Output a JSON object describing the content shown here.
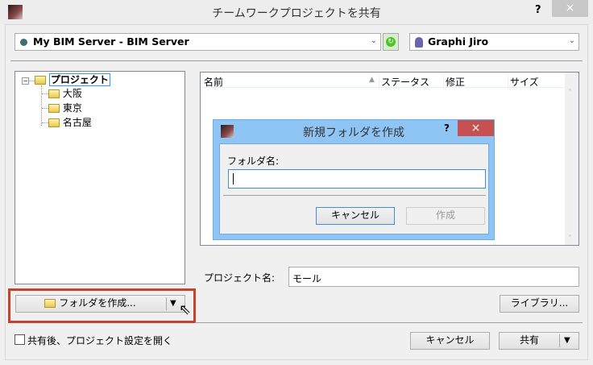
{
  "window": {
    "title": "チームワークプロジェクトを共有",
    "help": "?",
    "close": "×"
  },
  "server": {
    "selected": "My BIM Server - BIM Server"
  },
  "user": {
    "selected": "Graphi Jiro"
  },
  "tree": {
    "root": "プロジェクト",
    "children": [
      "大阪",
      "東京",
      "名古屋"
    ]
  },
  "list": {
    "columns": [
      "名前",
      "ステータス",
      "修正",
      "サイズ"
    ]
  },
  "dialog": {
    "title": "新規フォルダを作成",
    "help": "?",
    "close": "×",
    "label": "フォルダ名:",
    "value": "",
    "cancel": "キャンセル",
    "create": "作成"
  },
  "project_name": {
    "label": "プロジェクト名:",
    "value": "モール"
  },
  "buttons": {
    "create_folder": "フォルダを作成...",
    "library": "ライブラリ...",
    "cancel": "キャンセル",
    "share": "共有"
  },
  "checkbox": {
    "label": "共有後、プロジェクト設定を開く",
    "checked": false
  },
  "colors": {
    "highlight": "#c0452f",
    "dialog_frame": "#8fc5f5",
    "close_red": "#c75050"
  }
}
